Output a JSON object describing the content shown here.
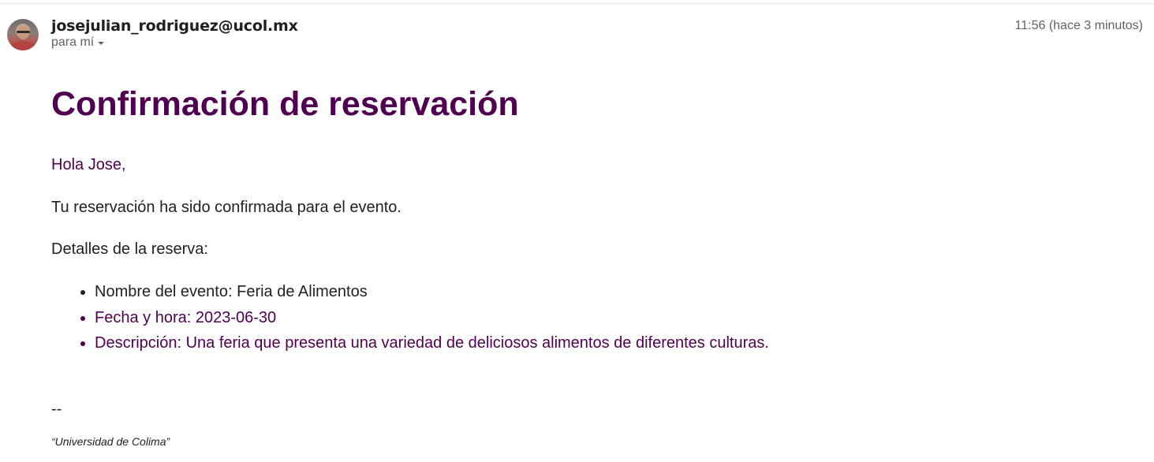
{
  "header": {
    "sender": "josejulian_rodriguez@ucol.mx",
    "recipient": "para mí",
    "time": "11:56 (hace 3 minutos)"
  },
  "message": {
    "title": "Confirmación de reservación",
    "greeting": "Hola Jose,",
    "confirmation": "Tu reservación ha sido confirmada para el evento.",
    "details_heading": "Detalles de la reserva:",
    "details": [
      "Nombre del evento: Feria de Alimentos",
      "Fecha y hora: 2023-06-30",
      "Descripción: Una feria que presenta una variedad de deliciosos alimentos de diferentes culturas."
    ],
    "signature_separator": "--",
    "signature": "“Universidad de Colima”"
  },
  "colors": {
    "accent_purple": "#500050",
    "text": "#222222",
    "meta": "#5f6368"
  }
}
